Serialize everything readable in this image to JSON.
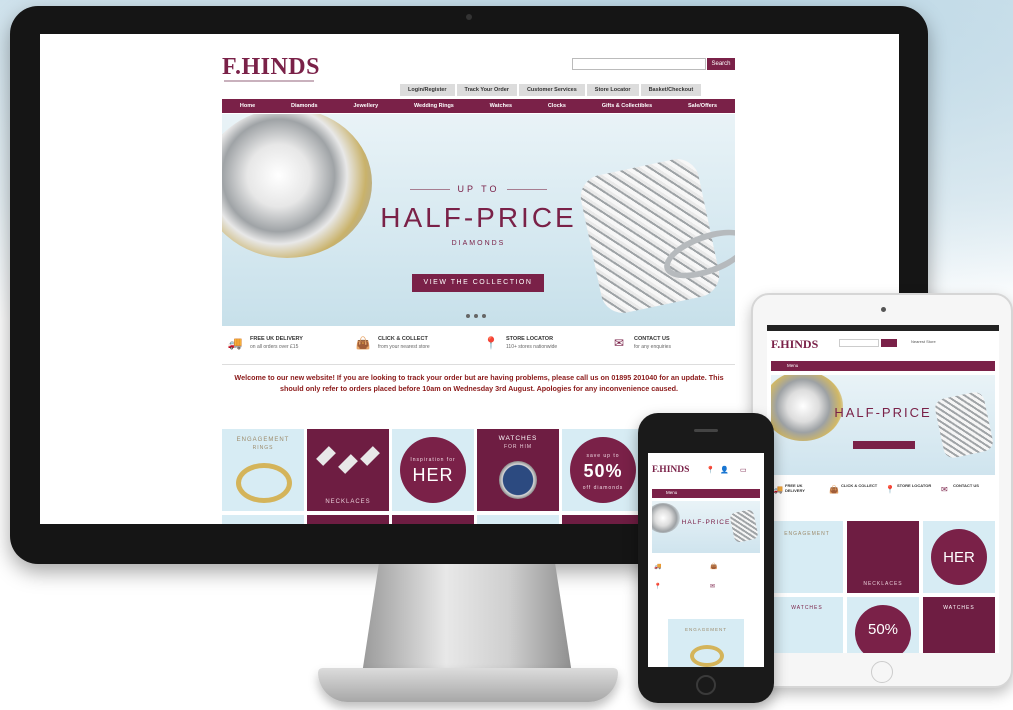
{
  "brand": {
    "name": "F.HINDS",
    "accent": "#7a2148"
  },
  "desktop": {
    "search_button": "Search",
    "util_nav": [
      "Login/Register",
      "Track Your Order",
      "Customer Services",
      "Store Locator",
      "Basket/Checkout"
    ],
    "main_nav": [
      "Home",
      "Diamonds",
      "Jewellery",
      "Wedding Rings",
      "Watches",
      "Clocks",
      "Gifts & Collectibles",
      "Sale/Offers"
    ],
    "hero": {
      "pretitle": "UP TO",
      "title": "HALF-PRICE",
      "subtitle": "DIAMONDS",
      "cta": "VIEW THE COLLECTION"
    },
    "features": [
      {
        "title": "FREE UK DELIVERY",
        "sub": "on all orders over £15",
        "icon": "truck-icon"
      },
      {
        "title": "CLICK & COLLECT",
        "sub": "from your nearest store",
        "icon": "bag-icon"
      },
      {
        "title": "STORE LOCATOR",
        "sub": "110+ stores nationwide",
        "icon": "pin-icon"
      },
      {
        "title": "CONTACT US",
        "sub": "for any enquiries",
        "icon": "envelope-icon"
      }
    ],
    "notice": "Welcome to our new website! If you are looking to track your order but are having problems, please call us on 01895 201040 for an update. This should only refer to orders placed before 10am on Wednesday 3rd August. Apologies for any inconvenience caused.",
    "tiles": {
      "engagement": "ENGAGEMENT",
      "engagement_sub": "RINGS",
      "necklaces": "NECKLACES",
      "her_small": "Inspiration for",
      "her": "HER",
      "watches": "WATCHES",
      "watches_sub": "FOR HIM",
      "offer_small": "save up to",
      "offer": "50%",
      "offer_sub": "off diamonds"
    }
  },
  "tablet": {
    "logo": "F.HINDS",
    "store": "Nearest Store",
    "menu": "Menu",
    "hero_title": "HALF-PRICE",
    "features": [
      "FREE UK DELIVERY",
      "CLICK & COLLECT",
      "STORE LOCATOR",
      "CONTACT US"
    ],
    "tile_engagement": "ENGAGEMENT",
    "tile_necklaces": "NECKLACES",
    "tile_her": "HER",
    "tile_watches": "WATCHES",
    "tile_offer": "50%"
  },
  "phone": {
    "logo": "F.HINDS",
    "menu": "Menu",
    "hero_title": "HALF-PRICE",
    "tile_engagement": "ENGAGEMENT"
  }
}
